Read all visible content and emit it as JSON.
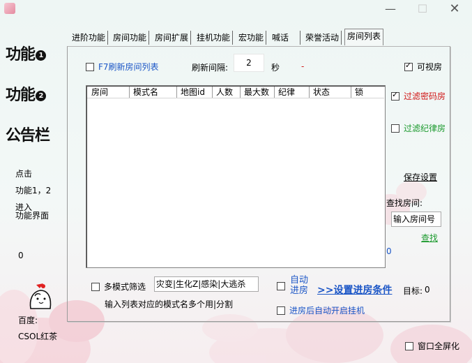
{
  "titlebar": {
    "min_icon": "minimize-icon",
    "max_icon": "maximize-icon",
    "close_icon": "close-icon"
  },
  "sidebar": {
    "nav": [
      {
        "label": "功能",
        "badge": "1"
      },
      {
        "label": "功能",
        "badge": "2"
      },
      {
        "label": "公告栏",
        "badge": ""
      }
    ],
    "hint_lines": [
      "点击",
      "功能1，2",
      "进入",
      "功能界面"
    ],
    "counter": "0",
    "footer_label": "百度:",
    "footer_value": "CSOL红茶"
  },
  "tabs": [
    {
      "label": "进阶功能"
    },
    {
      "label": "房间功能"
    },
    {
      "label": "房间扩展"
    },
    {
      "label": "挂机功能"
    },
    {
      "label": "宏功能"
    },
    {
      "label": "喊话"
    },
    {
      "label": "荣誉活动"
    },
    {
      "label": "房间列表"
    }
  ],
  "room_list_tab": {
    "f7_refresh_label": "F7刷新房间列表",
    "f7_refresh_checked": false,
    "interval_label": "刷新间隔:",
    "interval_value": "2",
    "interval_unit": "秒",
    "interval_status": "-",
    "visible_rooms_label": "可视房",
    "visible_rooms_checked": true,
    "filter_password_label": "过滤密码房",
    "filter_password_checked": true,
    "filter_discipline_label": "过滤纪律房",
    "filter_discipline_checked": false,
    "save_settings_label": "保存设置",
    "find_room_label": "查找房间:",
    "room_number_value": "输入房间号",
    "find_button_label": "查找",
    "find_result": "0",
    "columns": [
      "房间",
      "模式名",
      "地图id",
      "人数",
      "最大数",
      "纪律",
      "状态",
      "锁"
    ],
    "rows": [],
    "multi_mode_label": "多模式筛选",
    "multi_mode_checked": false,
    "multi_mode_value": "灾变|生化Z|感染|大逃杀",
    "multi_mode_hint": "输入列表对应的模式名多个用|分割",
    "auto_join_label_1": "自动",
    "auto_join_label_2": "进房",
    "auto_join_checked": false,
    "join_conditions_label": ">>设置进房条件",
    "target_label": "目标:",
    "target_value": "0",
    "auto_afk_label": "进房后自动开启挂机",
    "auto_afk_checked": false
  },
  "fullscreen_label": "窗口全屏化",
  "fullscreen_checked": false,
  "colors": {
    "link_blue": "#1a55c6",
    "warn_red": "#d01818",
    "ok_green": "#1c9a2e"
  }
}
